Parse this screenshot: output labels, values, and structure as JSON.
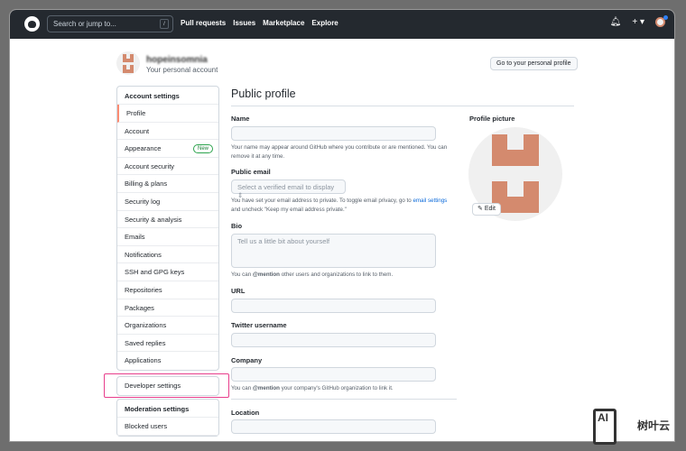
{
  "nav": {
    "search_placeholder": "Search or jump to...",
    "slash": "/",
    "links": [
      "Pull requests",
      "Issues",
      "Marketplace",
      "Explore"
    ],
    "plus": "+ ▾"
  },
  "user": {
    "name": "hopeinsomnia",
    "subtitle": "Your personal account",
    "go_profile": "Go to your personal profile"
  },
  "sidebar": {
    "header": "Account settings",
    "items": [
      {
        "label": "Profile"
      },
      {
        "label": "Account"
      },
      {
        "label": "Appearance",
        "badge": "New"
      },
      {
        "label": "Account security"
      },
      {
        "label": "Billing & plans"
      },
      {
        "label": "Security log"
      },
      {
        "label": "Security & analysis"
      },
      {
        "label": "Emails"
      },
      {
        "label": "Notifications"
      },
      {
        "label": "SSH and GPG keys"
      },
      {
        "label": "Repositories"
      },
      {
        "label": "Packages"
      },
      {
        "label": "Organizations"
      },
      {
        "label": "Saved replies"
      },
      {
        "label": "Applications"
      }
    ],
    "developer": "Developer settings",
    "moderation_header": "Moderation settings",
    "moderation_items": [
      "Blocked users"
    ]
  },
  "main": {
    "title": "Public profile",
    "name_label": "Name",
    "name_note": "Your name may appear around GitHub where you contribute or are mentioned. You can remove it at any time.",
    "email_label": "Public email",
    "email_select": "Select a verified email to display ⇕",
    "email_note_1": "You have set your email address to private. To toggle email privacy, go to ",
    "email_link": "email settings",
    "email_note_2": " and uncheck \"Keep my email address private.\"",
    "bio_label": "Bio",
    "bio_placeholder": "Tell us a little bit about yourself",
    "bio_note_1": "You can ",
    "bio_mention": "@mention",
    "bio_note_2": " other users and organizations to link to them.",
    "url_label": "URL",
    "twitter_label": "Twitter username",
    "company_label": "Company",
    "company_note_1": "You can ",
    "company_mention": "@mention",
    "company_note_2": " your company's GitHub organization to link it.",
    "location_label": "Location",
    "picture_label": "Profile picture",
    "edit": "Edit"
  },
  "watermark": {
    "logo": "AI",
    "text": "树叶云"
  }
}
